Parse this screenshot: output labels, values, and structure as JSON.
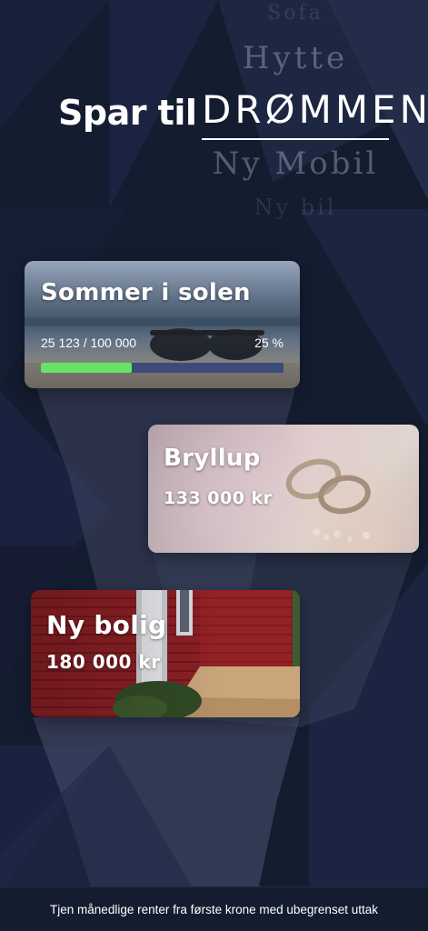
{
  "header": {
    "prefix": "Spar til",
    "words": {
      "top": "Sofa",
      "upper": "Hytte",
      "main": "DRØMMEN",
      "lower": "Ny Mobil",
      "bottom": "Ny bil"
    }
  },
  "cards": [
    {
      "title": "Sommer i solen",
      "saved": "25 123 / 100 000",
      "percent_label": "25 %",
      "progress": 0.25,
      "image": "sunglasses-on-beach"
    },
    {
      "title": "Bryllup",
      "amount": "133 000 kr",
      "image": "wedding-rings-on-flowers"
    },
    {
      "title": "Ny bolig",
      "amount": "180 000 kr",
      "image": "red-wooden-house"
    }
  ],
  "footer": {
    "text": "Tjen månedlige renter fra første krone med ubegrenset uttak"
  },
  "colors": {
    "background": "#141c30",
    "progress_fill": "#66e367",
    "progress_track": "#3e4a7a"
  }
}
